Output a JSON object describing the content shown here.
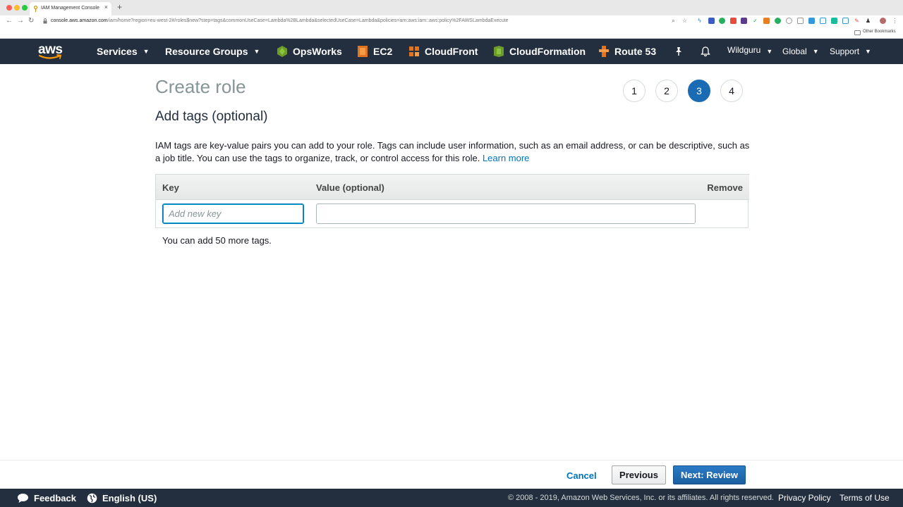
{
  "browser": {
    "tab_title": "IAM Management Console",
    "tab_close": "×",
    "new_tab": "+",
    "back": "←",
    "forward": "→",
    "reload": "↻",
    "url_host": "console.aws.amazon.com",
    "url_path": "/iam/home?region=eu-west-2#/roles$new?step=tags&commonUseCase=Lambda%2BLambda&selectedUseCase=Lambda&policies=arn:aws:iam::aws:policy%2FAWSLambdaExecute",
    "bookmarks_label": "Other Bookmarks"
  },
  "nav": {
    "logo": "aws",
    "services": "Services",
    "resource_groups": "Resource Groups",
    "pinned": [
      {
        "label": "OpsWorks",
        "icon": "opsworks-icon",
        "color": "#6c9c2b"
      },
      {
        "label": "EC2",
        "icon": "ec2-icon",
        "color": "#e2731f"
      },
      {
        "label": "CloudFront",
        "icon": "cloudfront-icon",
        "color": "#e2731f"
      },
      {
        "label": "CloudFormation",
        "icon": "cloudformation-icon",
        "color": "#6c9c2b"
      },
      {
        "label": "Route 53",
        "icon": "route53-icon",
        "color": "#e2731f"
      }
    ],
    "user": "Wildguru",
    "region": "Global",
    "support": "Support"
  },
  "main": {
    "title": "Create role",
    "steps": [
      "1",
      "2",
      "3",
      "4"
    ],
    "active_step": 3,
    "section_title": "Add tags (optional)",
    "description": "IAM tags are key-value pairs you can add to your role. Tags can include user information, such as an email address, or can be descriptive, such as a job title. You can use the tags to organize, track, or control access for this role.",
    "learn_more": "Learn more",
    "table": {
      "col_key": "Key",
      "col_value": "Value (optional)",
      "col_remove": "Remove",
      "key_placeholder": "Add new key",
      "key_value": "",
      "value_value": ""
    },
    "more_tags": "You can add 50 more tags."
  },
  "actions": {
    "cancel": "Cancel",
    "previous": "Previous",
    "next": "Next: Review"
  },
  "footer": {
    "feedback": "Feedback",
    "language": "English (US)",
    "copyright": "© 2008 - 2019, Amazon Web Services, Inc. or its affiliates. All rights reserved.",
    "privacy": "Privacy Policy",
    "terms": "Terms of Use"
  },
  "colors": {
    "nav_bg": "#232f3e",
    "primary": "#1a6bb4",
    "link": "#0073bb"
  }
}
